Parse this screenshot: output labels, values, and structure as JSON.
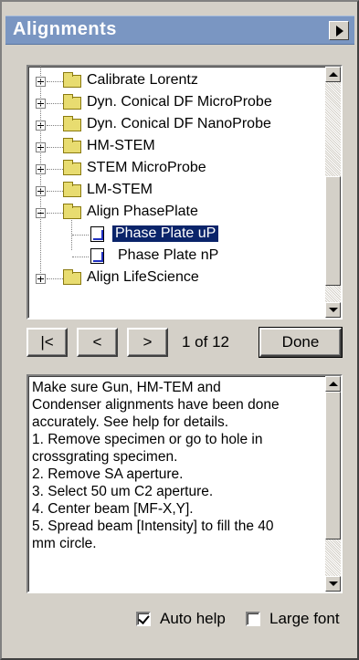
{
  "panel": {
    "title": "Alignments",
    "menu_icon": "triangle-right-icon"
  },
  "tree": {
    "items": [
      {
        "label": "Calibrate Lorentz",
        "expander": "plus",
        "icon": "folder-icon"
      },
      {
        "label": "Dyn. Conical DF MicroProbe",
        "expander": "plus",
        "icon": "folder-icon"
      },
      {
        "label": "Dyn. Conical DF NanoProbe",
        "expander": "plus",
        "icon": "folder-icon"
      },
      {
        "label": "HM-STEM",
        "expander": "plus",
        "icon": "folder-icon"
      },
      {
        "label": "STEM MicroProbe",
        "expander": "plus",
        "icon": "folder-icon"
      },
      {
        "label": "LM-STEM",
        "expander": "plus",
        "icon": "folder-icon"
      },
      {
        "label": "Align PhasePlate",
        "expander": "minus",
        "icon": "folder-icon"
      },
      {
        "label": "Phase Plate uP",
        "icon": "document-icon",
        "selected": true
      },
      {
        "label": "Phase Plate nP",
        "icon": "document-icon"
      },
      {
        "label": "Align LifeScience",
        "expander": "plus",
        "icon": "folder-icon"
      }
    ]
  },
  "nav": {
    "first_label": "|<",
    "prev_label": "<",
    "next_label": ">",
    "page_indicator": "1 of 12",
    "done_label": "Done"
  },
  "help": {
    "lines": [
      "Make sure Gun, HM-TEM and",
      "Condenser alignments have been done",
      "accurately. See help for details.",
      "1. Remove specimen or go to hole in",
      "crossgrating specimen.",
      "2. Remove SA aperture.",
      "3. Select 50 um C2 aperture.",
      "4. Center beam [MF-X,Y].",
      "5. Spread beam [Intensity] to fill the 40",
      "mm circle."
    ]
  },
  "options": {
    "auto_help": {
      "label": "Auto help",
      "checked": true
    },
    "large_font": {
      "label": "Large font",
      "checked": false
    }
  },
  "colors": {
    "titlebar": "#7a96c2",
    "selection": "#0a246a",
    "panel": "#d4d0c8"
  }
}
